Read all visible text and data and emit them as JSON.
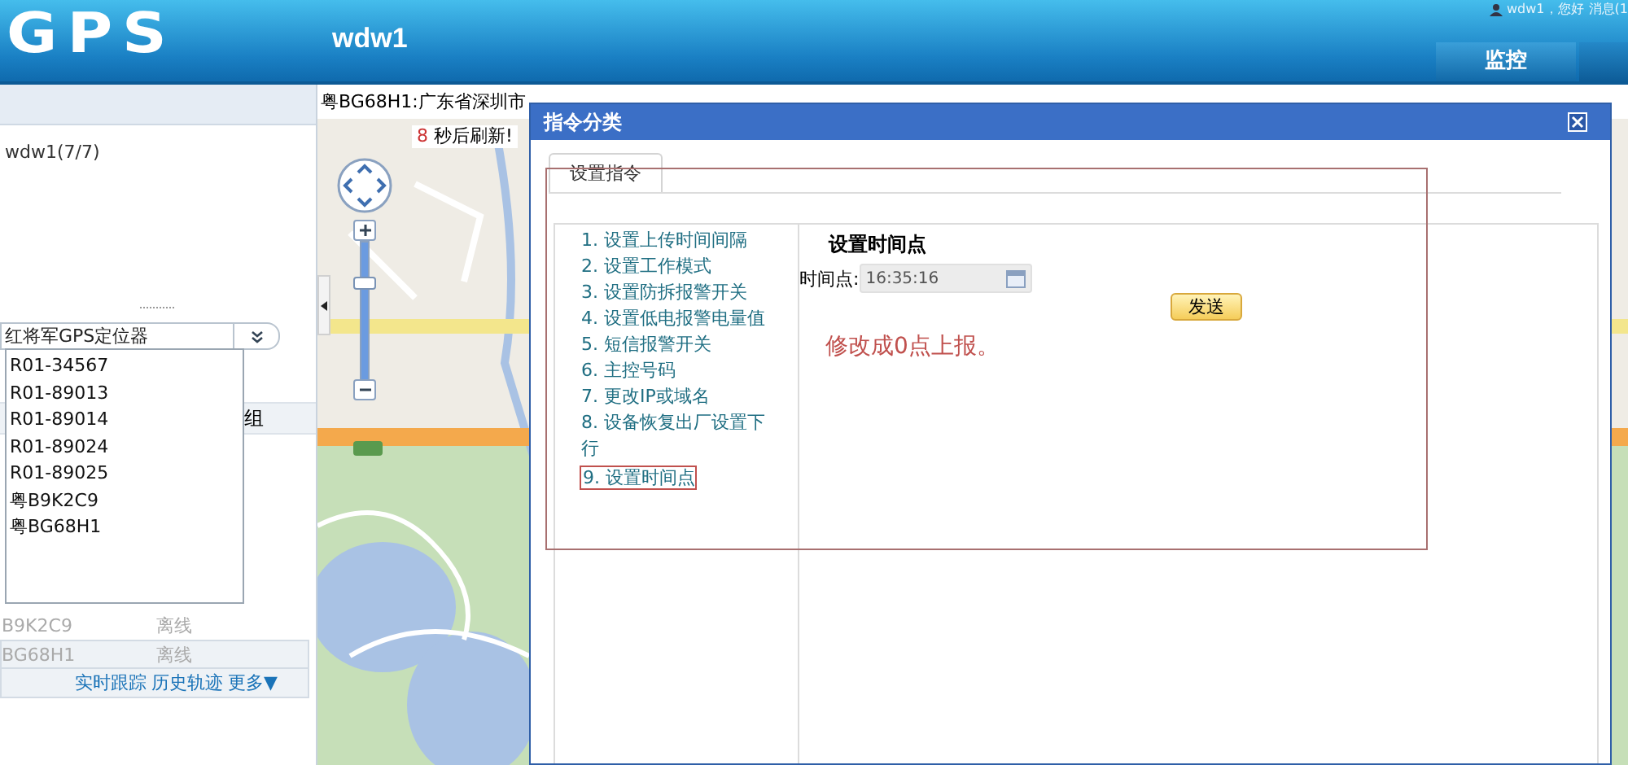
{
  "header": {
    "logo": "GPS",
    "user": "wdw1",
    "greeting": "wdw1，您好",
    "messages": "消息(1",
    "nav_tab": "监控"
  },
  "sidebar": {
    "tree_root": "wdw1(7/7)",
    "device_type_select": "红将军GPS定位器",
    "device_options": [
      "R01-34567",
      "R01-89013",
      "R01-89014",
      "R01-89024",
      "R01-89025",
      "粤B9K2C9",
      "粤BG68H1"
    ],
    "column_header": "组",
    "rows": [
      {
        "plate": "B9K2C9",
        "status": "离线",
        "selected": false
      },
      {
        "plate": "BG68H1",
        "status": "离线",
        "selected": true
      }
    ],
    "actions": [
      "实时跟踪",
      "历史轨迹",
      "更多▼"
    ]
  },
  "map": {
    "address": "粤BG68H1:广东省深圳市",
    "refresh_count": "8",
    "refresh_text": "秒后刷新!",
    "zoom": {
      "level": 0.73
    }
  },
  "dialog": {
    "title": "指令分类",
    "tabs": [
      {
        "label": "设置指令",
        "selected": true
      }
    ],
    "commands": [
      {
        "label": "1. 设置上传时间间隔",
        "selected": false
      },
      {
        "label": "2. 设置工作模式",
        "selected": false
      },
      {
        "label": "3. 设置防拆报警开关",
        "selected": false
      },
      {
        "label": "4. 设置低电报警电量值",
        "selected": false
      },
      {
        "label": "5. 短信报警开关",
        "selected": false
      },
      {
        "label": "6. 主控号码",
        "selected": false
      },
      {
        "label": "7. 更改IP或域名",
        "selected": false
      },
      {
        "label": "8. 设备恢复出厂设置下行",
        "selected": false
      },
      {
        "label": "9. 设置时间点",
        "selected": true
      }
    ],
    "form": {
      "heading": "设置时间点",
      "field_label": "时间点:",
      "value": "16:35:16",
      "button": "发送"
    }
  },
  "annotation": {
    "text": "修改成0点上报。"
  }
}
